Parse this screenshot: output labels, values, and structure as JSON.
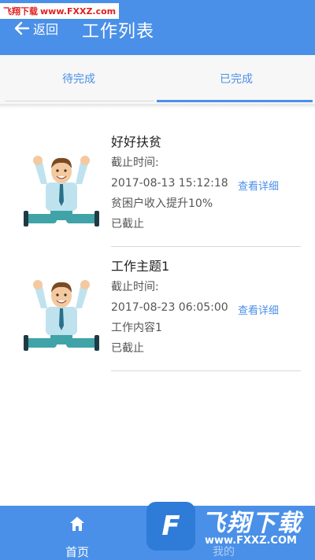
{
  "watermark": {
    "top_brand": "飞翔下载",
    "top_url": "www.FXXZ.com",
    "bottom_cn": "飞翔下载",
    "bottom_en": "www.FXXZ.COM"
  },
  "header": {
    "back_label": "返回",
    "title": "工作列表"
  },
  "tabs": [
    {
      "label": "待完成",
      "active": false
    },
    {
      "label": "已完成",
      "active": true
    }
  ],
  "items": [
    {
      "title": "好好扶贫",
      "deadline_label": "截止时间:",
      "deadline": "2017-08-13 15:12:18",
      "content": "贫困户收入提升10%",
      "status": "已截止",
      "action": "查看详细",
      "avatar_icon": "cheering-man-avatar"
    },
    {
      "title": "工作主题1",
      "deadline_label": "截止时间:",
      "deadline": "2017-08-23 06:05:00",
      "content": "工作内容1",
      "status": "已截止",
      "action": "查看详细",
      "avatar_icon": "cheering-man-avatar"
    }
  ],
  "bottom_nav": [
    {
      "label": "首页",
      "icon": "home-icon"
    },
    {
      "label": "我的",
      "icon": "user-icon"
    }
  ],
  "colors": {
    "primary": "#4a90e8",
    "divider": "#d8d8d8"
  }
}
